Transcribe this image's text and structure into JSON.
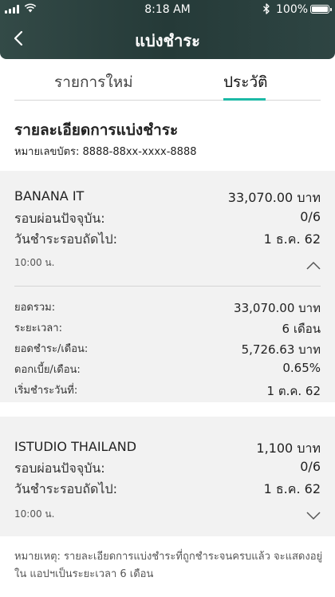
{
  "status_bar": {
    "time": "8:18 AM",
    "battery": "100%"
  },
  "header": {
    "title": "แบ่งชำระ"
  },
  "tabs": [
    {
      "label": "รายการใหม่"
    },
    {
      "label": "ประวัติ"
    }
  ],
  "details": {
    "title": "รายละเอียดการแบ่งชำระ",
    "card_number": "หมายเลขบัตร: 8888-88xx-xxxx-8888"
  },
  "plans": [
    {
      "merchant": "BANANA IT",
      "amount": "33,070.00 บาท",
      "rows": [
        {
          "label": "รอบผ่อนปัจจุบัน:",
          "value": "0/6"
        },
        {
          "label": "วันชำระรอบถัดไป:",
          "value": "1 ธ.ค. 62"
        }
      ],
      "time": "10:00 น.",
      "expanded_rows": [
        {
          "label": "ยอดรวม:",
          "value": "33,070.00 บาท"
        },
        {
          "label": "ระยะเวลา:",
          "value": "6 เดือน"
        },
        {
          "label": "ยอดชำระ/เดือน:",
          "value": "5,726.63 บาท"
        },
        {
          "label": "ดอกเบี้ย/เดือน:",
          "value": "0.65%"
        },
        {
          "label": "เริ่มชำระวันที่:",
          "value": "1 ต.ค. 62"
        }
      ]
    },
    {
      "merchant": "ISTUDIO THAILAND",
      "amount": "1,100 บาท",
      "rows": [
        {
          "label": "รอบผ่อนปัจจุบัน:",
          "value": "0/6"
        },
        {
          "label": "วันชำระรอบถัดไป:",
          "value": "1 ธ.ค. 62"
        }
      ],
      "time": "10:00 น."
    }
  ],
  "note": "หมายเหตุ: รายละเอียดการแบ่งชำระที่ถูกชำระจนครบแล้ว จะแสดงอยู่ใน แอปฯเป็นระยะเวลา 6 เดือน",
  "colors": {
    "accent": "#1cb9a6",
    "header_bg": "#2b4240",
    "card_bg": "#f2f2f2"
  }
}
